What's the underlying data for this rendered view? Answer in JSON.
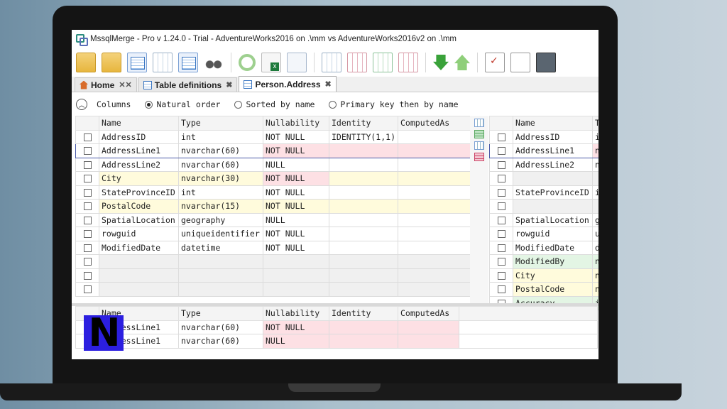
{
  "window": {
    "title": "MssqlMerge - Pro v 1.24.0 - Trial - AdventureWorks2016 on .\\mm vs AdventureWorks2016v2 on .\\mm"
  },
  "tabs": [
    {
      "label": "Home",
      "close": "✕✕"
    },
    {
      "label": "Table definitions",
      "close": "✖"
    },
    {
      "label": "Person.Address",
      "close": "✖"
    }
  ],
  "options": {
    "columns_label": "Columns",
    "natural_order": "Natural order",
    "sorted_by_name": "Sorted by name",
    "pk_then_name": "Primary key then by name",
    "selected": "natural_order"
  },
  "left_grid": {
    "headers": [
      "Name",
      "Type",
      "Nullability",
      "Identity",
      "ComputedAs"
    ],
    "rows": [
      {
        "name": "AddressID",
        "type": "int",
        "nullability": "NOT NULL",
        "identity": "IDENTITY(1,1)",
        "computed": "",
        "state": "same"
      },
      {
        "name": "AddressLine1",
        "type": "nvarchar(60)",
        "nullability": "NOT NULL",
        "identity": "",
        "computed": "",
        "state": "changed"
      },
      {
        "name": "AddressLine2",
        "type": "nvarchar(60)",
        "nullability": "NULL",
        "identity": "",
        "computed": "",
        "state": "same"
      },
      {
        "name": "City",
        "type": "nvarchar(30)",
        "nullability": "NOT NULL",
        "identity": "",
        "computed": "",
        "state": "moved"
      },
      {
        "name": "StateProvinceID",
        "type": "int",
        "nullability": "NOT NULL",
        "identity": "",
        "computed": "",
        "state": "same"
      },
      {
        "name": "PostalCode",
        "type": "nvarchar(15)",
        "nullability": "NOT NULL",
        "identity": "",
        "computed": "",
        "state": "moved"
      },
      {
        "name": "SpatialLocation",
        "type": "geography",
        "nullability": "NULL",
        "identity": "",
        "computed": "",
        "state": "same"
      },
      {
        "name": "rowguid",
        "type": "uniqueidentifier",
        "nullability": "NOT NULL",
        "identity": "",
        "computed": "",
        "state": "same"
      },
      {
        "name": "ModifiedDate",
        "type": "datetime",
        "nullability": "NOT NULL",
        "identity": "",
        "computed": "",
        "state": "same"
      }
    ],
    "empty_rows": 3
  },
  "right_grid": {
    "headers": [
      "Name",
      "T"
    ],
    "rows": [
      {
        "name": "AddressID",
        "type": "i",
        "state": "same"
      },
      {
        "name": "AddressLine1",
        "type": "n",
        "state": "changed"
      },
      {
        "name": "AddressLine2",
        "type": "n",
        "state": "same"
      },
      {
        "name": "",
        "type": "",
        "state": "gap"
      },
      {
        "name": "StateProvinceID",
        "type": "i",
        "state": "same"
      },
      {
        "name": "",
        "type": "",
        "state": "gap"
      },
      {
        "name": "SpatialLocation",
        "type": "g",
        "state": "same"
      },
      {
        "name": "rowguid",
        "type": "u",
        "state": "same"
      },
      {
        "name": "ModifiedDate",
        "type": "d",
        "state": "same"
      },
      {
        "name": "ModifiedBy",
        "type": "n",
        "state": "added"
      },
      {
        "name": "City",
        "type": "n",
        "state": "moved"
      },
      {
        "name": "PostalCode",
        "type": "n",
        "state": "moved"
      },
      {
        "name": "Accuracy",
        "type": "i",
        "state": "added"
      }
    ]
  },
  "bottom_grid": {
    "headers": [
      "Name",
      "Type",
      "Nullability",
      "Identity",
      "ComputedAs"
    ],
    "rows": [
      {
        "name": "AddressLine1",
        "type": "nvarchar(60)",
        "nullability": "NOT NULL"
      },
      {
        "name": "AddressLine1",
        "type": "nvarchar(60)",
        "nullability": "NULL"
      }
    ]
  },
  "overlay_logo": "N"
}
